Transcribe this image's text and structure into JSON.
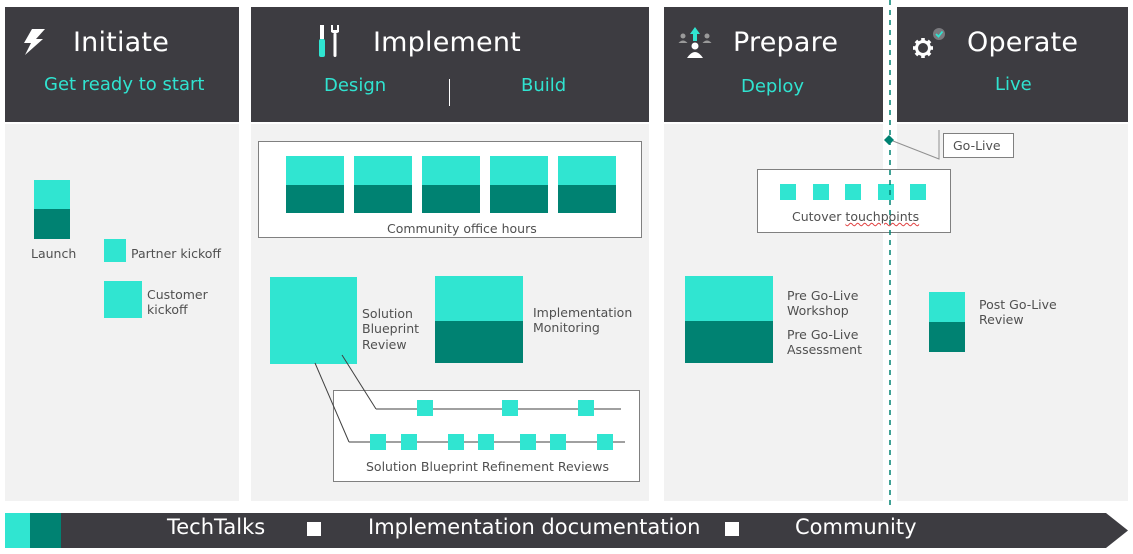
{
  "colors": {
    "header_bg": "#3d3c41",
    "panel_bg": "#f2f2f2",
    "accent_light": "#30e5d1",
    "accent_dark": "#008272",
    "subtitle": "#30e3d0"
  },
  "phases": [
    {
      "title": "Initiate",
      "icon": "lightning-icon",
      "subtitle": "Get ready to start"
    },
    {
      "title": "Implement",
      "icon": "tools-icon",
      "subtitles": [
        "Design",
        "Build"
      ]
    },
    {
      "title": "Prepare",
      "icon": "deploy-people-icon",
      "subtitle": "Deploy"
    },
    {
      "title": "Operate",
      "icon": "gear-check-icon",
      "subtitle": "Live"
    }
  ],
  "initiate": {
    "launch": "Launch",
    "partner_kickoff": "Partner kickoff",
    "customer_kickoff": [
      "Customer",
      "kickoff"
    ]
  },
  "implement": {
    "office_hours": {
      "label": "Community office hours",
      "count": 5
    },
    "blueprint_review": [
      "Solution",
      "Blueprint",
      "Review"
    ],
    "monitoring": [
      "Implementation",
      "Monitoring"
    ],
    "refinement": {
      "label": "Solution Blueprint Refinement Reviews",
      "row1_count": 3,
      "row2_count": 7
    }
  },
  "prepare": {
    "cutover": {
      "label": "Cutover touchpoints",
      "count": 5
    },
    "workshop": [
      "Pre Go-Live",
      "Workshop"
    ],
    "assessment": [
      "Pre Go-Live",
      "Assessment"
    ]
  },
  "operate": {
    "go_live": "Go-Live",
    "post_review": [
      "Post Go-Live",
      "Review"
    ]
  },
  "bottom_bar": {
    "items": [
      "TechTalks",
      "Implementation documentation",
      "Community"
    ]
  }
}
